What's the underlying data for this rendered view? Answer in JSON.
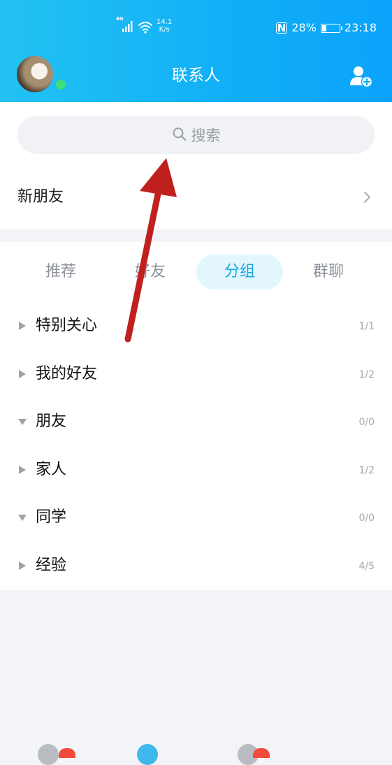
{
  "status_bar": {
    "network": "4G",
    "speed_value": "14.1",
    "speed_unit": "K/s",
    "nfc": "N",
    "battery_percent_text": "28%",
    "battery_level": 0.28,
    "time": "23:18"
  },
  "header": {
    "title": "联系人",
    "add_contact_icon": "add-person-icon",
    "online_color": "#3fde76",
    "accent_gradient": [
      "#22c3f2",
      "#0aa3fb"
    ]
  },
  "search": {
    "placeholder": "搜索",
    "icon": "search-icon"
  },
  "new_friends": {
    "label": "新朋友",
    "icon": "chevron-right-icon"
  },
  "tabs": [
    {
      "label": "推荐",
      "active": false
    },
    {
      "label": "好友",
      "active": false
    },
    {
      "label": "分组",
      "active": true
    },
    {
      "label": "群聊",
      "active": false
    }
  ],
  "groups": [
    {
      "name": "特别关心",
      "count": "1/1",
      "expanded": false
    },
    {
      "name": "我的好友",
      "count": "1/2",
      "expanded": false
    },
    {
      "name": "朋友",
      "count": "0/0",
      "expanded": true
    },
    {
      "name": "家人",
      "count": "1/2",
      "expanded": false
    },
    {
      "name": "同学",
      "count": "0/0",
      "expanded": true
    },
    {
      "name": "经验",
      "count": "4/5",
      "expanded": false
    }
  ],
  "colors": {
    "accent": "#12a7e8",
    "tab_active_bg": "#e4f6fd",
    "annotation_arrow": "#c0211f",
    "badge": "#f24b3c"
  }
}
